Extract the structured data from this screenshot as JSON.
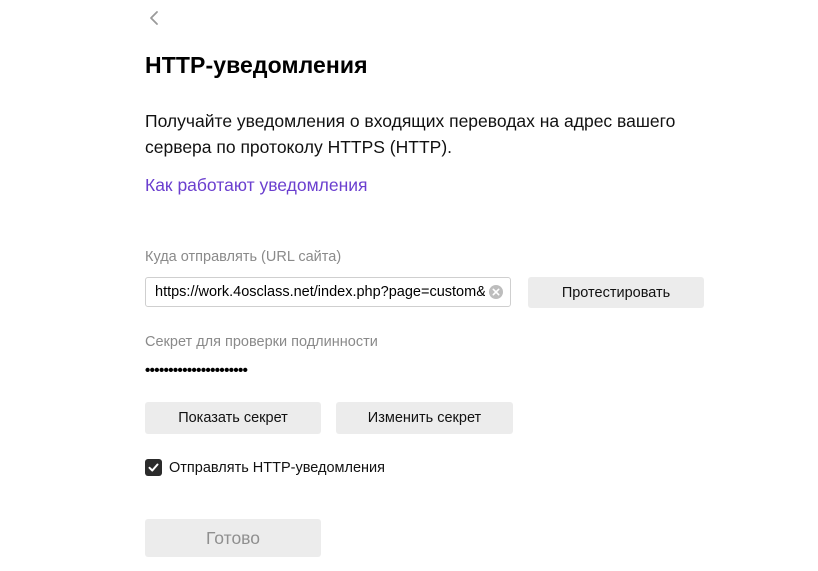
{
  "icons": {
    "back": "chevron-left-icon",
    "clear": "clear-circle-icon",
    "checkbox": "checkmark-icon"
  },
  "colors": {
    "link": "#6b3fcf",
    "button_bg": "#ececec",
    "checkbox_bg": "#2b2b2b",
    "label": "#8a8a8a"
  },
  "header": {
    "title": "HTTP-уведомления"
  },
  "description": {
    "line1": "Получайте уведомления о входящих переводах на адрес вашего",
    "line2": "сервера по протоколу HTTPS (HTTP)."
  },
  "help_link": {
    "label": "Как работают уведомления"
  },
  "url_section": {
    "label": "Куда отправлять (URL сайта)",
    "value": "https://work.4osclass.net/index.php?page=custom&",
    "placeholder": "",
    "test_button_label": "Протестировать"
  },
  "secret_section": {
    "label": "Секрет для проверки подлинности",
    "masked_value": "••••••••••••••••••••••",
    "show_button_label": "Показать секрет",
    "change_button_label": "Изменить секрет"
  },
  "notifications_toggle": {
    "label": "Отправлять HTTP-уведомления",
    "checked": true
  },
  "footer": {
    "done_button_label": "Готово"
  }
}
